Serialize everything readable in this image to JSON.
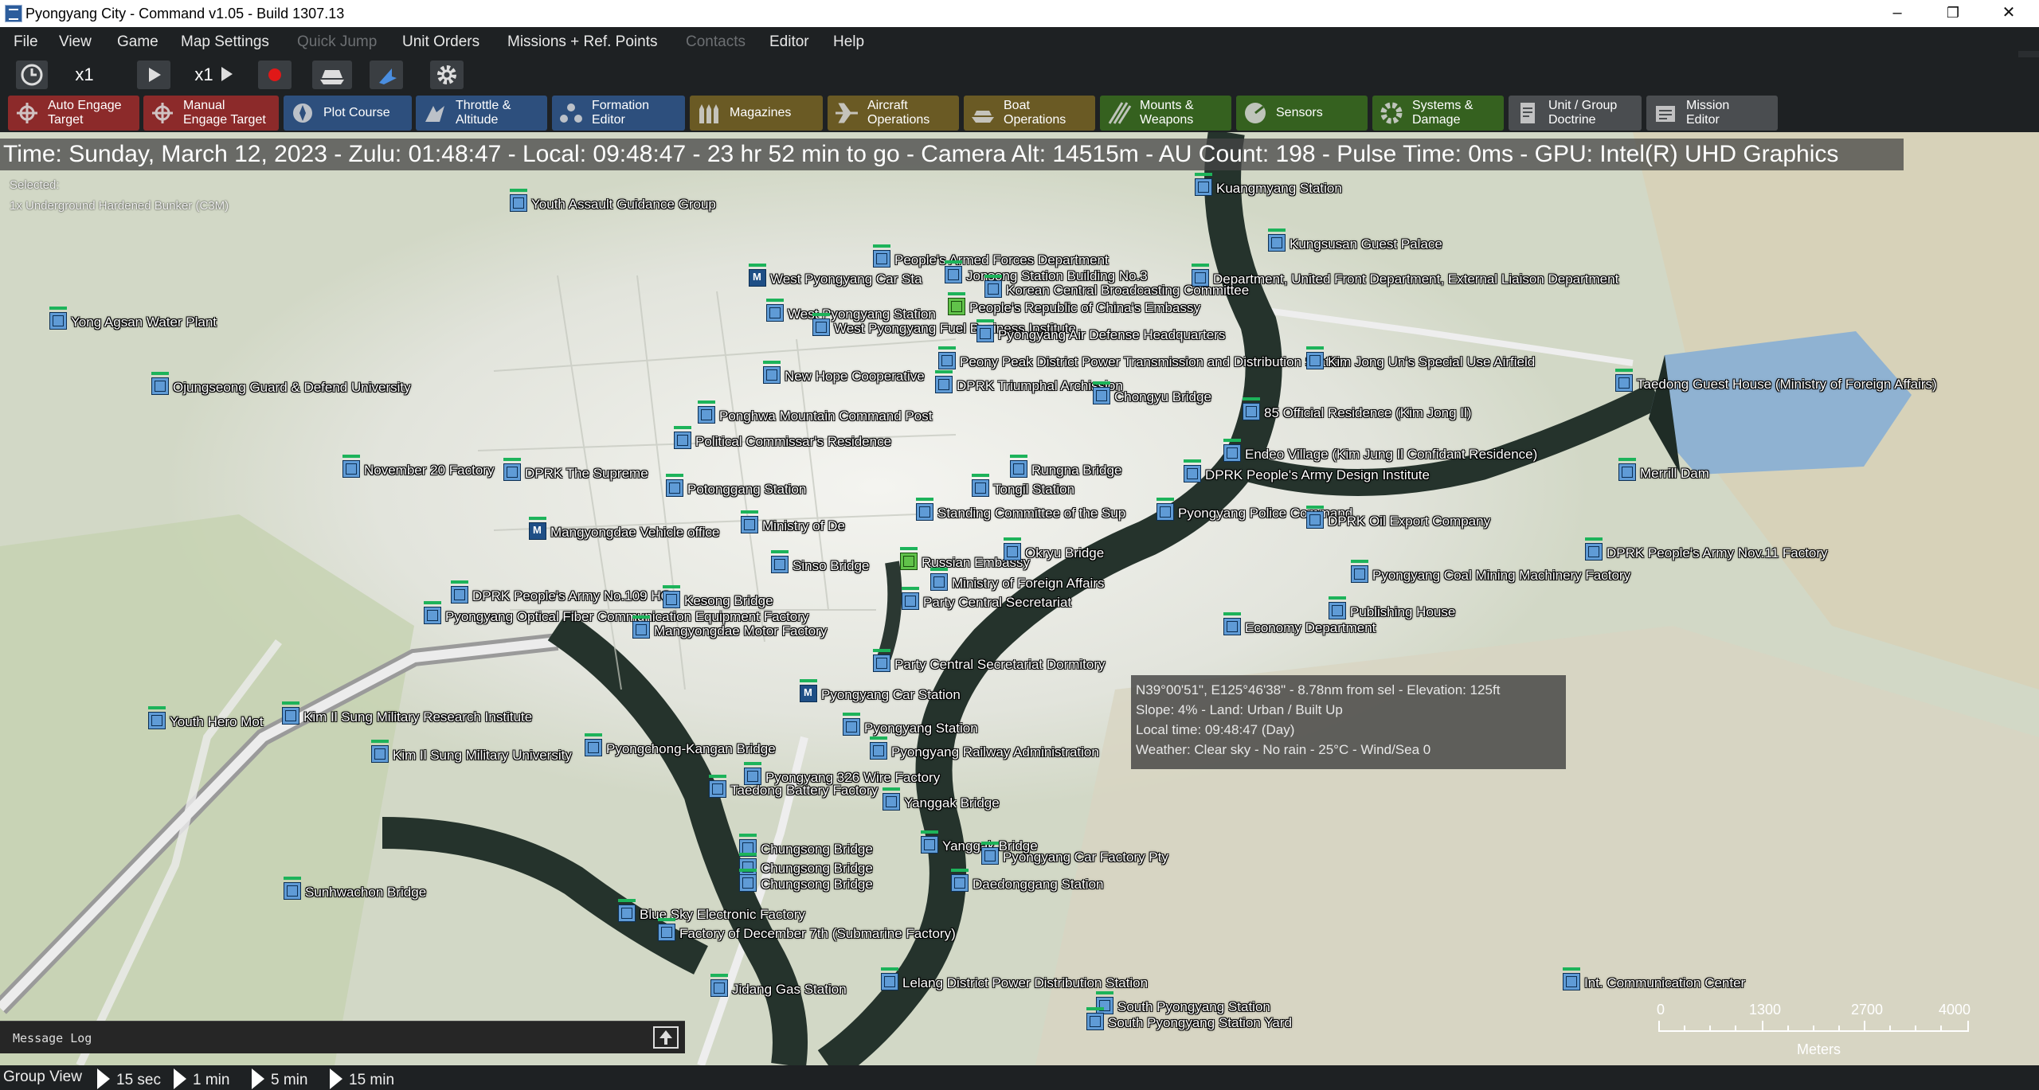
{
  "window": {
    "title": "Pyongyang City - Command v1.05 - Build 1307.13",
    "controls": [
      "–",
      "❐",
      "✕"
    ]
  },
  "menu": {
    "items": [
      {
        "label": "File",
        "enabled": true
      },
      {
        "label": "View",
        "enabled": true
      },
      {
        "label": "Game",
        "enabled": true
      },
      {
        "label": "Map Settings",
        "enabled": true
      },
      {
        "label": "Quick Jump",
        "enabled": false
      },
      {
        "label": "Unit Orders",
        "enabled": true
      },
      {
        "label": "Missions + Ref. Points",
        "enabled": true
      },
      {
        "label": "Contacts",
        "enabled": false
      },
      {
        "label": "Editor",
        "enabled": true
      },
      {
        "label": "Help",
        "enabled": true
      }
    ]
  },
  "toolbar": {
    "time_compression_1": "x1",
    "time_compression_2": "x1",
    "icons": [
      "clock-icon",
      "play-icon",
      "step-icon",
      "record-icon",
      "ship-icon",
      "pointer-icon",
      "gear-icon"
    ]
  },
  "actions": [
    {
      "label": "Auto Engage\nTarget",
      "color": "#8c2a2a",
      "icon": "target-icon"
    },
    {
      "label": "Manual\nEngage Target",
      "color": "#8c2a2a",
      "icon": "target-icon"
    },
    {
      "label": "Plot Course",
      "color": "#2d4f7d",
      "icon": "compass-icon"
    },
    {
      "label": "Throttle &\nAltitude",
      "color": "#2d4f7d",
      "icon": "throttle-icon"
    },
    {
      "label": "Formation\nEditor",
      "color": "#2d4f7d",
      "icon": "formation-icon"
    },
    {
      "label": "Magazines",
      "color": "#6a5a24",
      "icon": "ammo-icon"
    },
    {
      "label": "Aircraft\nOperations",
      "color": "#6a5a24",
      "icon": "aircraft-icon"
    },
    {
      "label": "Boat\nOperations",
      "color": "#6a5a24",
      "icon": "boat-icon"
    },
    {
      "label": "Mounts &\nWeapons",
      "color": "#35611f",
      "icon": "weapons-icon"
    },
    {
      "label": "Sensors",
      "color": "#35611f",
      "icon": "radar-icon"
    },
    {
      "label": "Systems &\nDamage",
      "color": "#35611f",
      "icon": "gear-icon"
    },
    {
      "label": "Unit / Group\nDoctrine",
      "color": "#4a4d50",
      "icon": "doctrine-icon"
    },
    {
      "label": "Mission\nEditor",
      "color": "#4a4d50",
      "icon": "mission-icon"
    }
  ],
  "status": {
    "line": "Time: Sunday, March 12, 2023 - Zulu: 01:48:47 - Local: 09:48:47 - 23 hr 52 min to go -  Camera Alt: 14515m  - AU Count: 198 - Pulse Time: 0ms - GPU: Intel(R) UHD Graphics"
  },
  "selection": {
    "title": "Selected:",
    "unit": "1x Underground Hardened Bunker (C3M)"
  },
  "units": [
    {
      "label": "Youth Assault Guidance Group",
      "type": "b"
    },
    {
      "label": "Kuangmyang Station",
      "type": "b"
    },
    {
      "label": "Kungsusan Guest Palace",
      "type": "b"
    },
    {
      "label": "People's Armed Forces Department",
      "type": "b"
    },
    {
      "label": "West Pyongyang Car Sta",
      "type": "m"
    },
    {
      "label": "Jonsong Station Building No.3",
      "type": "b"
    },
    {
      "label": "Department, United Front Department, External Liaison Department",
      "type": "b"
    },
    {
      "label": "Korean Central Broadcasting Committee",
      "type": "b"
    },
    {
      "label": "People's Republic of China's Embassy",
      "type": "g"
    },
    {
      "label": "Yong Agsan Water Plant",
      "type": "b"
    },
    {
      "label": "West Pyongyang Station",
      "type": "b"
    },
    {
      "label": "West Pyongyang Fuel Business Institute",
      "type": "b"
    },
    {
      "label": "Pyongyang Air Defense Headquarters",
      "type": "b"
    },
    {
      "label": "Peony Peak District Power Transmission and Distribution Station",
      "type": "b"
    },
    {
      "label": "Kim Jong Un's Special Use Airfield",
      "type": "b"
    },
    {
      "label": "New Hope Cooperative",
      "type": "b"
    },
    {
      "label": "DPRK Triumphal Archission",
      "type": "b"
    },
    {
      "label": "Taedong Guest House (Ministry of Foreign Affairs)",
      "type": "b"
    },
    {
      "label": "Ojungseong Guard & Defend University",
      "type": "b"
    },
    {
      "label": "Chongyu Bridge",
      "type": "b"
    },
    {
      "label": "Ponghwa Mountain Command Post",
      "type": "b"
    },
    {
      "label": "85 Official Residence (Kim Jong Il)",
      "type": "b"
    },
    {
      "label": "Political Commissar's Residence",
      "type": "b"
    },
    {
      "label": "Endeo Village (Kim Jung Il Confidant Residence)",
      "type": "b"
    },
    {
      "label": "November 20 Factory",
      "type": "b"
    },
    {
      "label": "DPRK The Supreme",
      "type": "b"
    },
    {
      "label": "Potonggang Station",
      "type": "b"
    },
    {
      "label": "Tongil Station",
      "type": "b"
    },
    {
      "label": "Rungna Bridge",
      "type": "b"
    },
    {
      "label": "DPRK People's Army Design Institute",
      "type": "b"
    },
    {
      "label": "Merrill Dam",
      "type": "b"
    },
    {
      "label": "Mangyongdae Vehicle office",
      "type": "m"
    },
    {
      "label": "Ministry of De",
      "type": "b"
    },
    {
      "label": "Standing Committee of the Sup",
      "type": "b"
    },
    {
      "label": "Pyongyang Police Command",
      "type": "b"
    },
    {
      "label": "DPRK Oil Export Company",
      "type": "b"
    },
    {
      "label": "DPRK People's Army Nov.11 Factory",
      "type": "b"
    },
    {
      "label": "Sinso Bridge",
      "type": "b"
    },
    {
      "label": "Russian Embassy",
      "type": "g"
    },
    {
      "label": "Okryu Bridge",
      "type": "b"
    },
    {
      "label": "Pyongyang Coal Mining Machinery Factory",
      "type": "b"
    },
    {
      "label": "Ministry of Foreign Affairs",
      "type": "b"
    },
    {
      "label": "DPRK People's Army No.109 HQ",
      "type": "b"
    },
    {
      "label": "Kesong Bridge",
      "type": "b"
    },
    {
      "label": "Pyongyang Optical Fiber Communication Equipment Factory",
      "type": "b"
    },
    {
      "label": "Mangyongdae Motor Factory",
      "type": "b"
    },
    {
      "label": "Party Central Secretariat",
      "type": "b"
    },
    {
      "label": "Publishing House",
      "type": "b"
    },
    {
      "label": "Economy Department",
      "type": "b"
    },
    {
      "label": "Party Central Secretariat Dormitory",
      "type": "b"
    },
    {
      "label": "Pyongyang Car Station",
      "type": "m"
    },
    {
      "label": "Pyongyang Station",
      "type": "b"
    },
    {
      "label": "Youth Hero Mot",
      "type": "b"
    },
    {
      "label": "Kim Il Sung Military Research Institute",
      "type": "b"
    },
    {
      "label": "Kim Il Sung Military University",
      "type": "b"
    },
    {
      "label": "Pyongchong-Kangan Bridge",
      "type": "b"
    },
    {
      "label": "Pyongyang Railway Administration",
      "type": "b"
    },
    {
      "label": "Pyongyang 326 Wire Factory",
      "type": "b"
    },
    {
      "label": "Taedong Battery Factory",
      "type": "b"
    },
    {
      "label": "Yanggak Bridge",
      "type": "b"
    },
    {
      "label": "Chungsong Bridge",
      "type": "b"
    },
    {
      "label": "Chungsong Bridge",
      "type": "b"
    },
    {
      "label": "Chungsong Bridge",
      "type": "b"
    },
    {
      "label": "Yanggak Bridge",
      "type": "b"
    },
    {
      "label": "Pyongyang Car Factory Pty",
      "type": "b"
    },
    {
      "label": "Daedonggang Station",
      "type": "b"
    },
    {
      "label": "Sunhwachon Bridge",
      "type": "b"
    },
    {
      "label": "Blue Sky Electronic Factory",
      "type": "b"
    },
    {
      "label": "Factory of December 7th (Submarine Factory)",
      "type": "b"
    },
    {
      "label": "Jidang Gas Station",
      "type": "b"
    },
    {
      "label": "Lelang District Power Distribution Station",
      "type": "b"
    },
    {
      "label": "South Pyongyang Station",
      "type": "b"
    },
    {
      "label": "South Pyongyang Station Yard",
      "type": "b"
    },
    {
      "label": "Int. Communication Center",
      "type": "b"
    }
  ],
  "tooltip": {
    "line1": "N39°00'51\", E125°46'38\" - 8.78nm from sel - Elevation: 125ft",
    "line2": "Slope: 4%   - Land: Urban / Built Up",
    "line3": "Local time: 09:48:47 (Day)",
    "line4": "Weather: Clear sky - No rain - 25°C - Wind/Sea 0"
  },
  "scale": {
    "ticks": [
      "0",
      "1300",
      "2700",
      "4000"
    ],
    "unit": "Meters"
  },
  "message_log": {
    "label": "Message Log"
  },
  "bottom": {
    "group_view": "Group View",
    "steps": [
      "15 sec",
      "1 min",
      "5 min",
      "15 min"
    ]
  }
}
